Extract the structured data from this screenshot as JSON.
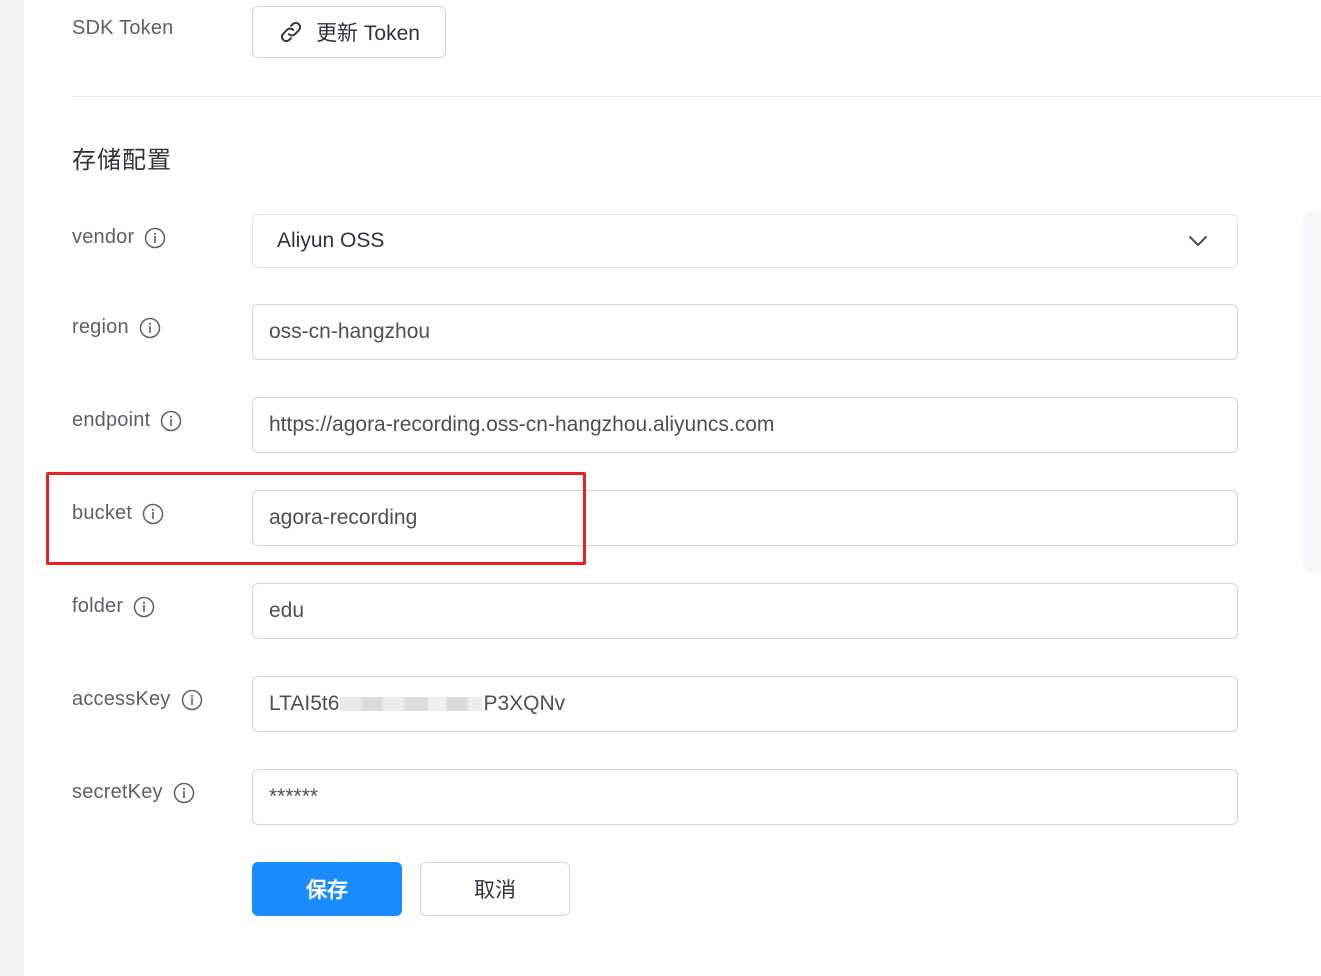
{
  "sdk_token": {
    "label": "SDK Token",
    "button_label": "更新 Token",
    "button_icon": "link-icon"
  },
  "storage": {
    "title": "存储配置",
    "fields": [
      {
        "label": "vendor",
        "value": "Aliyun OSS",
        "kind": "select"
      },
      {
        "label": "region",
        "value": "oss-cn-hangzhou"
      },
      {
        "label": "endpoint",
        "value": "https://agora-recording.oss-cn-hangzhou.aliyuncs.com"
      },
      {
        "label": "bucket",
        "value": "agora-recording"
      },
      {
        "label": "folder",
        "value": "edu"
      },
      {
        "label": "accessKey",
        "value_prefix": "LTAI5t6",
        "value_suffix": "P3XQNv"
      },
      {
        "label": "secretKey",
        "value": "******"
      }
    ]
  },
  "actions": {
    "save_label": "保存",
    "cancel_label": "取消"
  },
  "colors": {
    "primary": "#1a8cff",
    "highlight": "#e5231f",
    "border": "#d3d6dc",
    "text": "#4a4f5a"
  }
}
